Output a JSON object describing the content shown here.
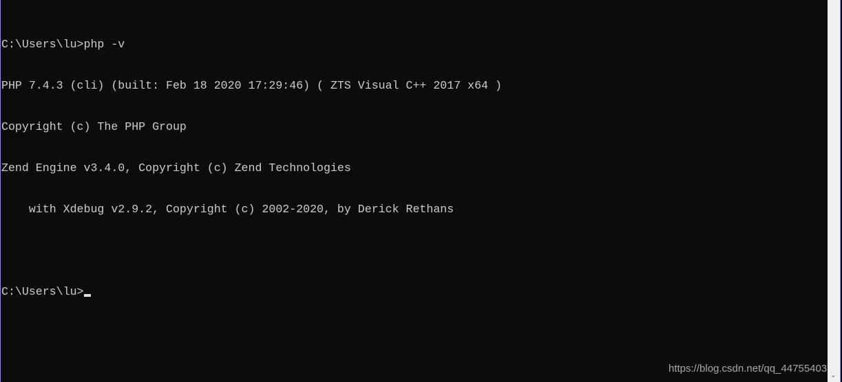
{
  "console": {
    "lines": [
      "C:\\Users\\lu>php -v",
      "PHP 7.4.3 (cli) (built: Feb 18 2020 17:29:46) ( ZTS Visual C++ 2017 x64 )",
      "Copyright (c) The PHP Group",
      "Zend Engine v3.4.0, Copyright (c) Zend Technologies",
      "    with Xdebug v2.9.2, Copyright (c) 2002-2020, by Derick Rethans",
      "",
      "C:\\Users\\lu>"
    ]
  },
  "watermark": "https://blog.csdn.net/qq_44755403",
  "colors": {
    "background": "#0c0c0c",
    "text": "#cccccc",
    "scrollbar": "#f0f0f0",
    "border": "#8f8fe0"
  }
}
